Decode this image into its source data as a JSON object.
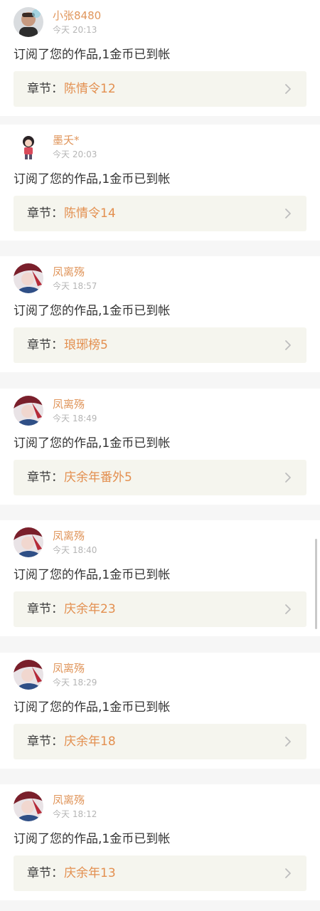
{
  "notifications": [
    {
      "user": "小张8480",
      "time": "今天 20:13",
      "message": "订阅了您的作品,1金币已到帐",
      "chapter_label": "章节：",
      "chapter": "陈情令12",
      "avatar": "avatar-photo"
    },
    {
      "user": "墨夭*",
      "time": "今天 20:03",
      "message": "订阅了您的作品,1金币已到帐",
      "chapter_label": "章节：",
      "chapter": "陈情令14",
      "avatar": "avatar-cartoon"
    },
    {
      "user": "凤离殇",
      "time": "今天 18:57",
      "message": "订阅了您的作品,1金币已到帐",
      "chapter_label": "章节：",
      "chapter": "琅琊榜5",
      "avatar": "avatar-anime"
    },
    {
      "user": "凤离殇",
      "time": "今天 18:49",
      "message": "订阅了您的作品,1金币已到帐",
      "chapter_label": "章节：",
      "chapter": "庆余年番外5",
      "avatar": "avatar-anime"
    },
    {
      "user": "凤离殇",
      "time": "今天 18:40",
      "message": "订阅了您的作品,1金币已到帐",
      "chapter_label": "章节：",
      "chapter": "庆余年23",
      "avatar": "avatar-anime"
    },
    {
      "user": "凤离殇",
      "time": "今天 18:29",
      "message": "订阅了您的作品,1金币已到帐",
      "chapter_label": "章节：",
      "chapter": "庆余年18",
      "avatar": "avatar-anime"
    },
    {
      "user": "凤离殇",
      "time": "今天 18:12",
      "message": "订阅了您的作品,1金币已到帐",
      "chapter_label": "章节：",
      "chapter": "庆余年13",
      "avatar": "avatar-anime"
    }
  ],
  "colors": {
    "username": "#e0965c",
    "chapter_name": "#e38f4f",
    "chapter_bg": "#f5f5ee",
    "separator": "#f6f6f6"
  }
}
